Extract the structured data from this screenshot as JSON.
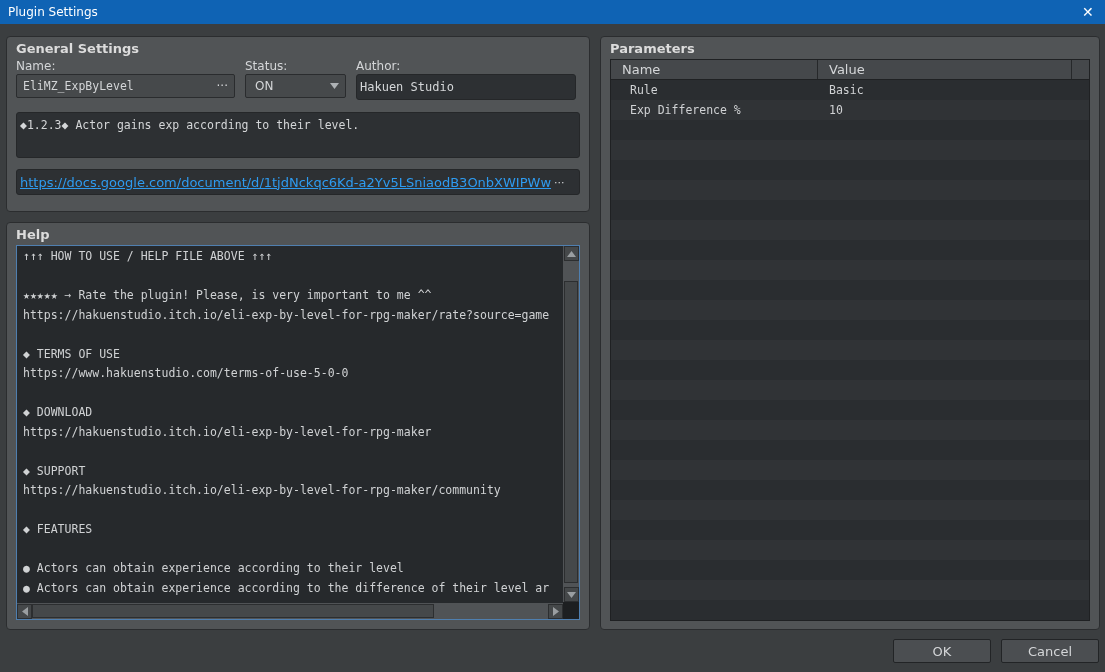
{
  "window": {
    "title": "Plugin Settings",
    "close": "✕"
  },
  "general": {
    "title": "General Settings",
    "name_label": "Name:",
    "name": "EliMZ_ExpByLevel",
    "name_more": "···",
    "status_label": "Status:",
    "status": "ON",
    "author_label": "Author:",
    "author": "Hakuen Studio",
    "description": "◆1.2.3◆ Actor gains exp according to their level.",
    "link": "https://docs.google.com/document/d/1tjdNckqc6Kd-a2Yv5LSniaodB3OnbXWIPWw",
    "link_more": "···"
  },
  "help": {
    "title": "Help",
    "paragraphs": [
      {
        "lines": [
          "↑↑↑ HOW TO USE / HELP FILE ABOVE ↑↑↑"
        ]
      },
      {
        "lines": [
          "★★★★★ → Rate the plugin! Please, is very important to me ^^",
          "https://hakuenstudio.itch.io/eli-exp-by-level-for-rpg-maker/rate?source=game"
        ]
      },
      {
        "lines": [
          "◆ TERMS OF USE",
          "https://www.hakuenstudio.com/terms-of-use-5-0-0"
        ]
      },
      {
        "lines": [
          "◆ DOWNLOAD",
          "https://hakuenstudio.itch.io/eli-exp-by-level-for-rpg-maker"
        ]
      },
      {
        "lines": [
          "◆ SUPPORT",
          "https://hakuenstudio.itch.io/eli-exp-by-level-for-rpg-maker/community"
        ]
      },
      {
        "lines": [
          "◆ FEATURES"
        ]
      },
      {
        "lines": [
          "● Actors can obtain experience according to their level",
          "● Actors can obtain experience according to the difference of their level ar"
        ]
      }
    ]
  },
  "parameters": {
    "title": "Parameters",
    "columns": [
      "Name",
      "Value"
    ],
    "rows": [
      {
        "name": "Rule",
        "value": "Basic"
      },
      {
        "name": "Exp Difference %",
        "value": "10"
      }
    ]
  },
  "buttons": [
    "OK",
    "Cancel"
  ]
}
